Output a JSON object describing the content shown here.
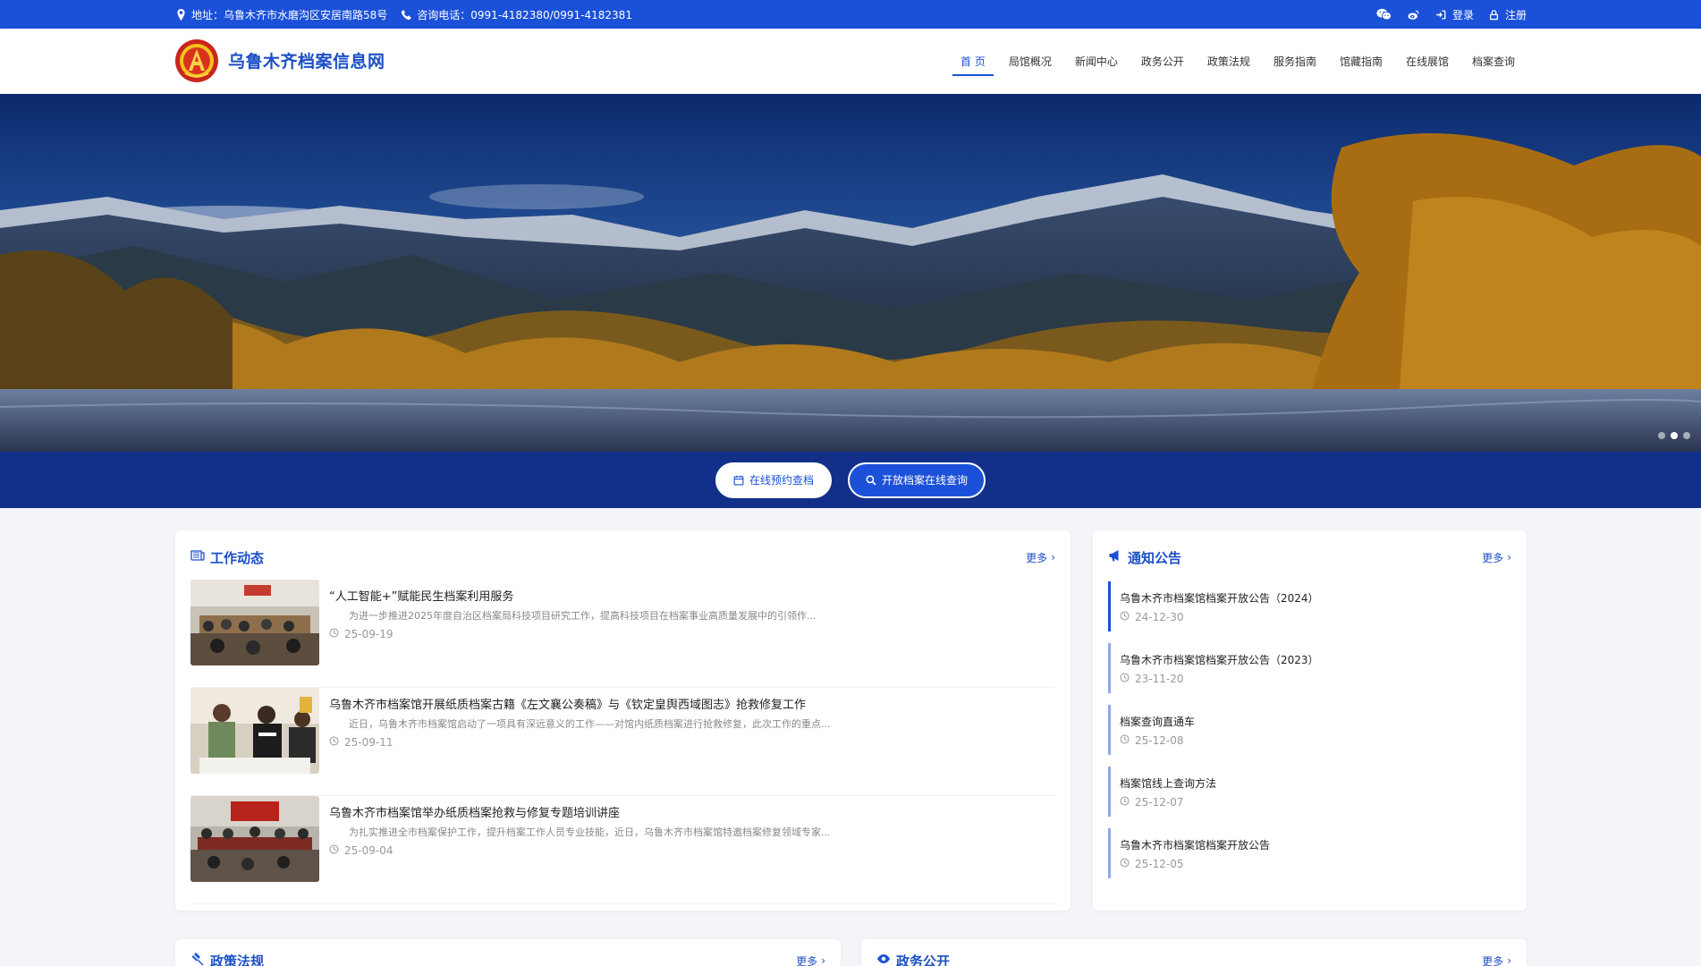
{
  "topbar": {
    "address": "地址：乌鲁木齐市水磨沟区安居南路58号",
    "phone": "咨询电话：0991-4182380/0991-4182381",
    "login": "登录",
    "register": "注册"
  },
  "header": {
    "site_title": "乌鲁木齐档案信息网",
    "nav": [
      "首 页",
      "局馆概况",
      "新闻中心",
      "政务公开",
      "政策法规",
      "服务指南",
      "馆藏指南",
      "在线展馆",
      "档案查询"
    ]
  },
  "banner": {
    "slide_count": 3,
    "active_slide": 2
  },
  "actions": {
    "reserve": "在线预约查档",
    "search": "开放档案在线查询"
  },
  "work_news": {
    "title": "工作动态",
    "more": "更多",
    "items": [
      {
        "title": "“人工智能+”赋能民生档案利用服务",
        "summary": "为进一步推进2025年度自治区档案局科技项目研究工作，提高科技项目在档案事业高质量发展中的引领作...",
        "date": "25-09-19"
      },
      {
        "title": "乌鲁木齐市档案馆开展纸质档案古籍《左文襄公奏稿》与《钦定皇舆西域图志》抢救修复工作",
        "summary": "近日，乌鲁木齐市档案馆启动了一项具有深远意义的工作——对馆内纸质档案进行抢救修复，此次工作的重点...",
        "date": "25-09-11"
      },
      {
        "title": "乌鲁木齐市档案馆举办纸质档案抢救与修复专题培训讲座",
        "summary": "为扎实推进全市档案保护工作，提升档案工作人员专业技能，近日，乌鲁木齐市档案馆特邀档案修复领域专家...",
        "date": "25-09-04"
      }
    ]
  },
  "notices": {
    "title": "通知公告",
    "more": "更多",
    "items": [
      {
        "title": "乌鲁木齐市档案馆档案开放公告（2024）",
        "date": "24-12-30"
      },
      {
        "title": "乌鲁木齐市档案馆档案开放公告（2023）",
        "date": "23-11-20"
      },
      {
        "title": "档案查询直通车",
        "date": "25-12-08"
      },
      {
        "title": "档案馆线上查询方法",
        "date": "25-12-07"
      },
      {
        "title": "乌鲁木齐市档案馆档案开放公告",
        "date": "25-12-05"
      }
    ]
  },
  "policy": {
    "title": "政策法规",
    "more": "更多"
  },
  "gov_open": {
    "title": "政务公开",
    "more": "更多"
  },
  "colors": {
    "primary": "#1b50d8",
    "strip": "#12308a",
    "title": "#1b4fc4"
  }
}
